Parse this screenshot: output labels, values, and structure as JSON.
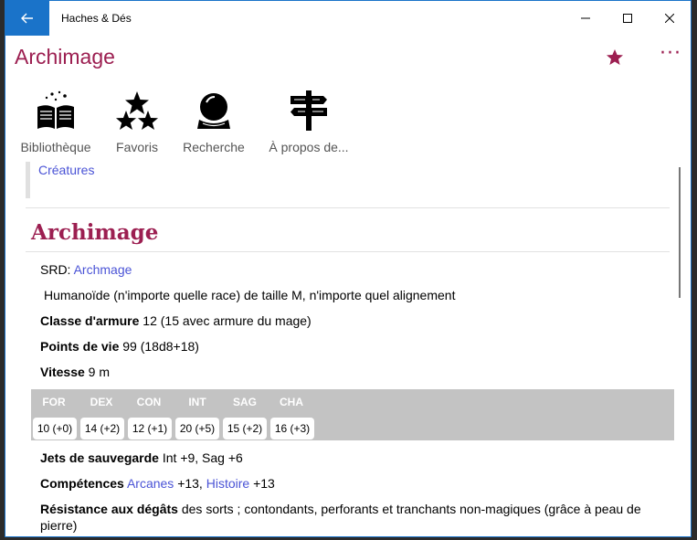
{
  "titlebar": {
    "app_title": "Haches & Dés"
  },
  "header": {
    "title": "Archimage",
    "more_label": "···"
  },
  "nav": [
    {
      "label": "Bibliothèque",
      "icon": "library-book-icon"
    },
    {
      "label": "Favoris",
      "icon": "stars-icon"
    },
    {
      "label": "Recherche",
      "icon": "crystal-ball-icon"
    },
    {
      "label": "À propos de...",
      "icon": "signpost-icon"
    }
  ],
  "content": {
    "breadcrumb_link": "Créatures",
    "heading": "Archimage",
    "srd_label": "SRD:",
    "srd_link": "Archmage",
    "type_line": "Humanoïde (n'importe quelle race) de taille M, n'importe quel alignement",
    "ac_label": "Classe d'armure",
    "ac_value": "12 (15 avec armure du mage)",
    "hp_label": "Points de vie",
    "hp_value": "99 (18d8+18)",
    "speed_label": "Vitesse",
    "speed_value": "9 m",
    "stats": [
      {
        "name": "FOR",
        "value": "10 (+0)"
      },
      {
        "name": "DEX",
        "value": "14 (+2)"
      },
      {
        "name": "CON",
        "value": "12 (+1)"
      },
      {
        "name": "INT",
        "value": "20 (+5)"
      },
      {
        "name": "SAG",
        "value": "15 (+2)"
      },
      {
        "name": "CHA",
        "value": "16 (+3)"
      }
    ],
    "saves_label": "Jets de sauvegarde",
    "saves_value": "Int +9, Sag +6",
    "skills_label": "Compétences",
    "skill1": "Arcanes",
    "skill1_bonus": "+13,",
    "skill2": "Histoire",
    "skill2_bonus": "+13",
    "resist_label": "Résistance aux dégâts",
    "resist_value": "des sorts ; contondants, perforants et tranchants non-magiques (grâce à peau de",
    "resist_value_2": "pierre)"
  },
  "colors": {
    "accent": "#9c1f51",
    "titlebar_accent": "#1a73c9",
    "link": "#4a53d6",
    "stat_bg": "#c3c3c3"
  }
}
